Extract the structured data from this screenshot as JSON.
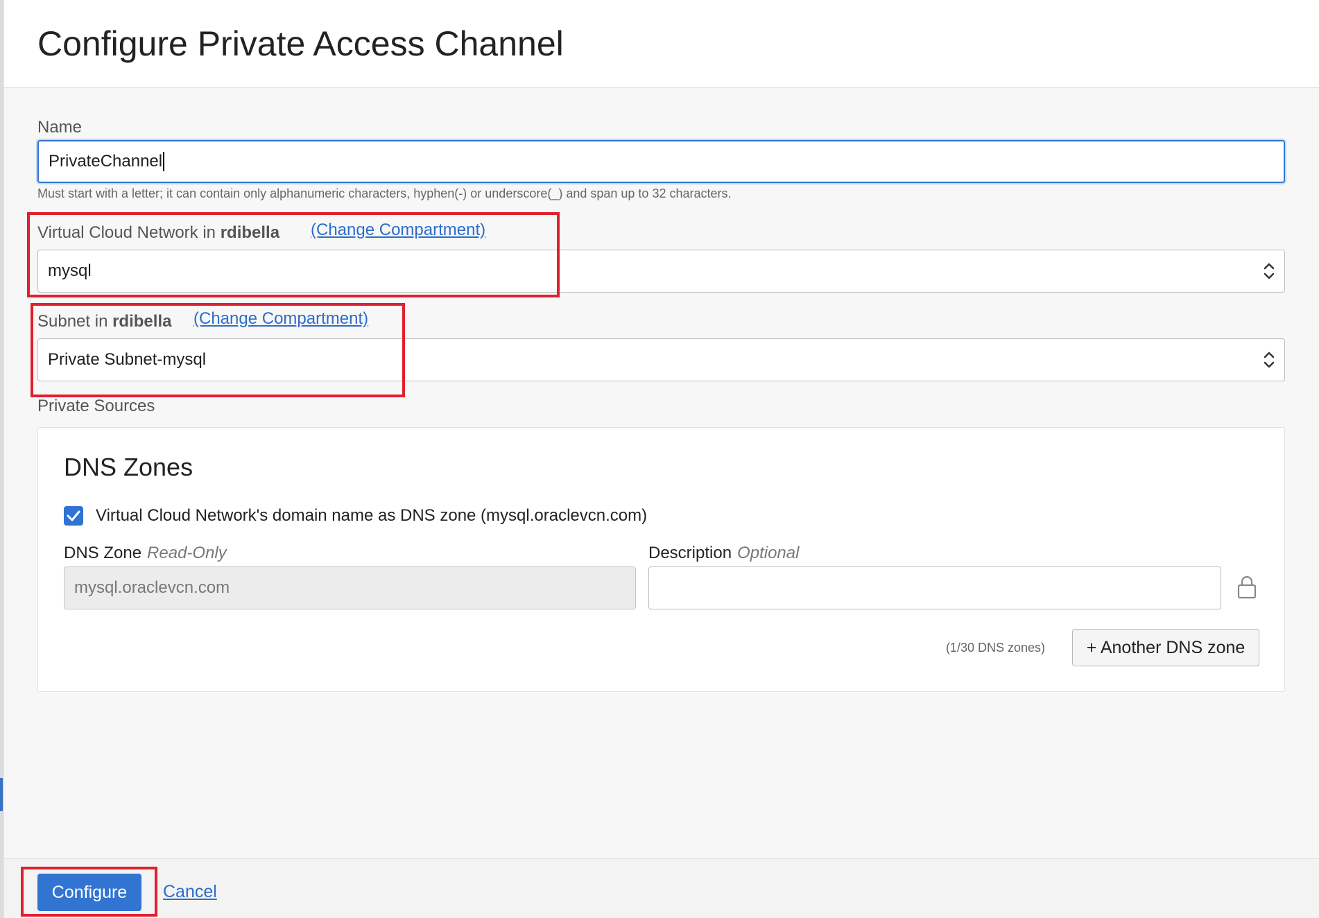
{
  "dialog": {
    "title": "Configure Private Access Channel"
  },
  "name_field": {
    "label": "Name",
    "value": "PrivateChannel",
    "hint": "Must start with a letter; it can contain only alphanumeric characters, hyphen(-) or underscore(_) and span up to 32 characters."
  },
  "vcn_field": {
    "label_prefix": "Virtual Cloud Network in",
    "compartment": "rdibella",
    "change_link": "(Change Compartment)",
    "value": "mysql"
  },
  "subnet_field": {
    "label_prefix": "Subnet in",
    "compartment": "rdibella",
    "change_link": "(Change Compartment)",
    "value": "Private Subnet-mysql"
  },
  "private_sources": {
    "label": "Private Sources",
    "dns_zones": {
      "title": "DNS Zones",
      "checkbox_label": "Virtual Cloud Network's domain name as DNS zone (mysql.oraclevcn.com)",
      "checkbox_checked": true,
      "dns_zone_label": "DNS Zone",
      "dns_zone_sub": "Read-Only",
      "dns_zone_value": "mysql.oraclevcn.com",
      "description_label": "Description",
      "description_sub": "Optional",
      "description_value": "",
      "count_text": "(1/30 DNS zones)",
      "add_button": "+ Another DNS zone"
    }
  },
  "footer": {
    "configure_button": "Configure",
    "cancel_link": "Cancel"
  },
  "colors": {
    "accent": "#3174d2",
    "link": "#2c6dc9",
    "highlight": "#e0202e"
  },
  "icons": {
    "select": "chevron-up-down-icon",
    "checkbox": "checkmark-icon",
    "lock": "lock-icon"
  }
}
